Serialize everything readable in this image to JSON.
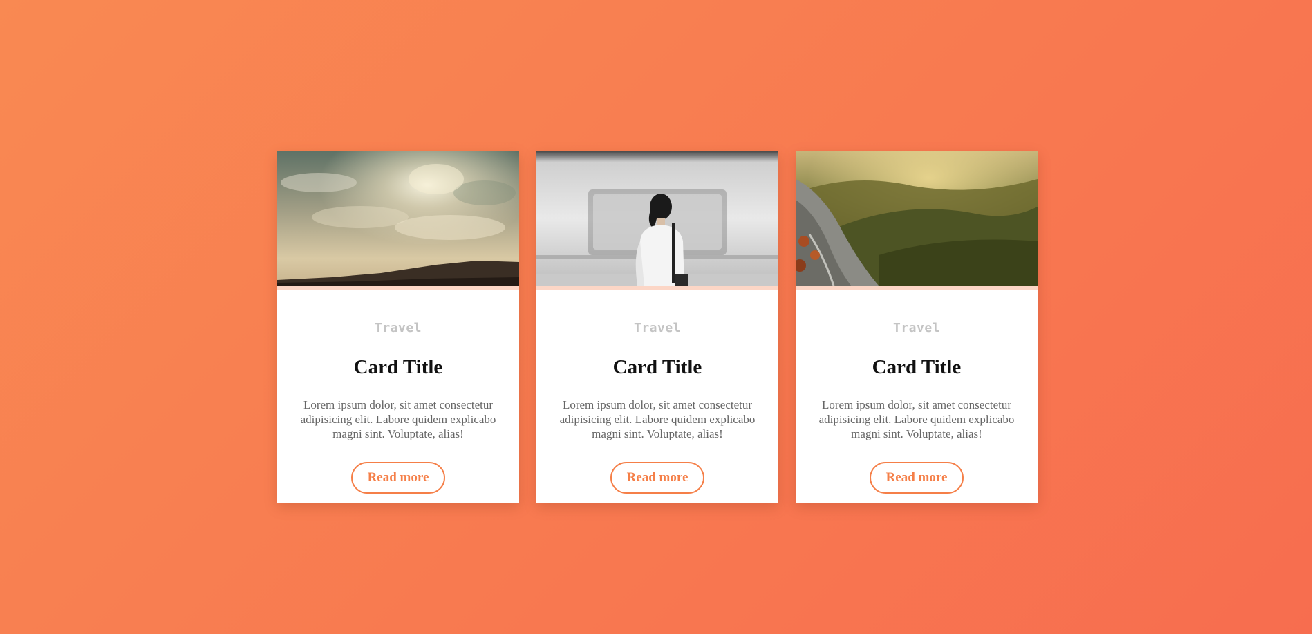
{
  "accent_color": "#f57f48",
  "background_gradient": [
    "#f98952",
    "#f76d4f"
  ],
  "cards": [
    {
      "image": "sky-clouds-desert-photo",
      "category": "Travel",
      "title": "Card Title",
      "description": "Lorem ipsum dolor, sit amet consectetur adipisicing elit. Labore quidem explicabo magni sint. Voluptate, alias!",
      "button_label": "Read more"
    },
    {
      "image": "woman-subway-train-photo",
      "category": "Travel",
      "title": "Card Title",
      "description": "Lorem ipsum dolor, sit amet consectetur adipisicing elit. Labore quidem explicabo magni sint. Voluptate, alias!",
      "button_label": "Read more"
    },
    {
      "image": "forest-mountain-cliff-photo",
      "category": "Travel",
      "title": "Card Title",
      "description": "Lorem ipsum dolor, sit amet consectetur adipisicing elit. Labore quidem explicabo magni sint. Voluptate, alias!",
      "button_label": "Read more"
    }
  ]
}
